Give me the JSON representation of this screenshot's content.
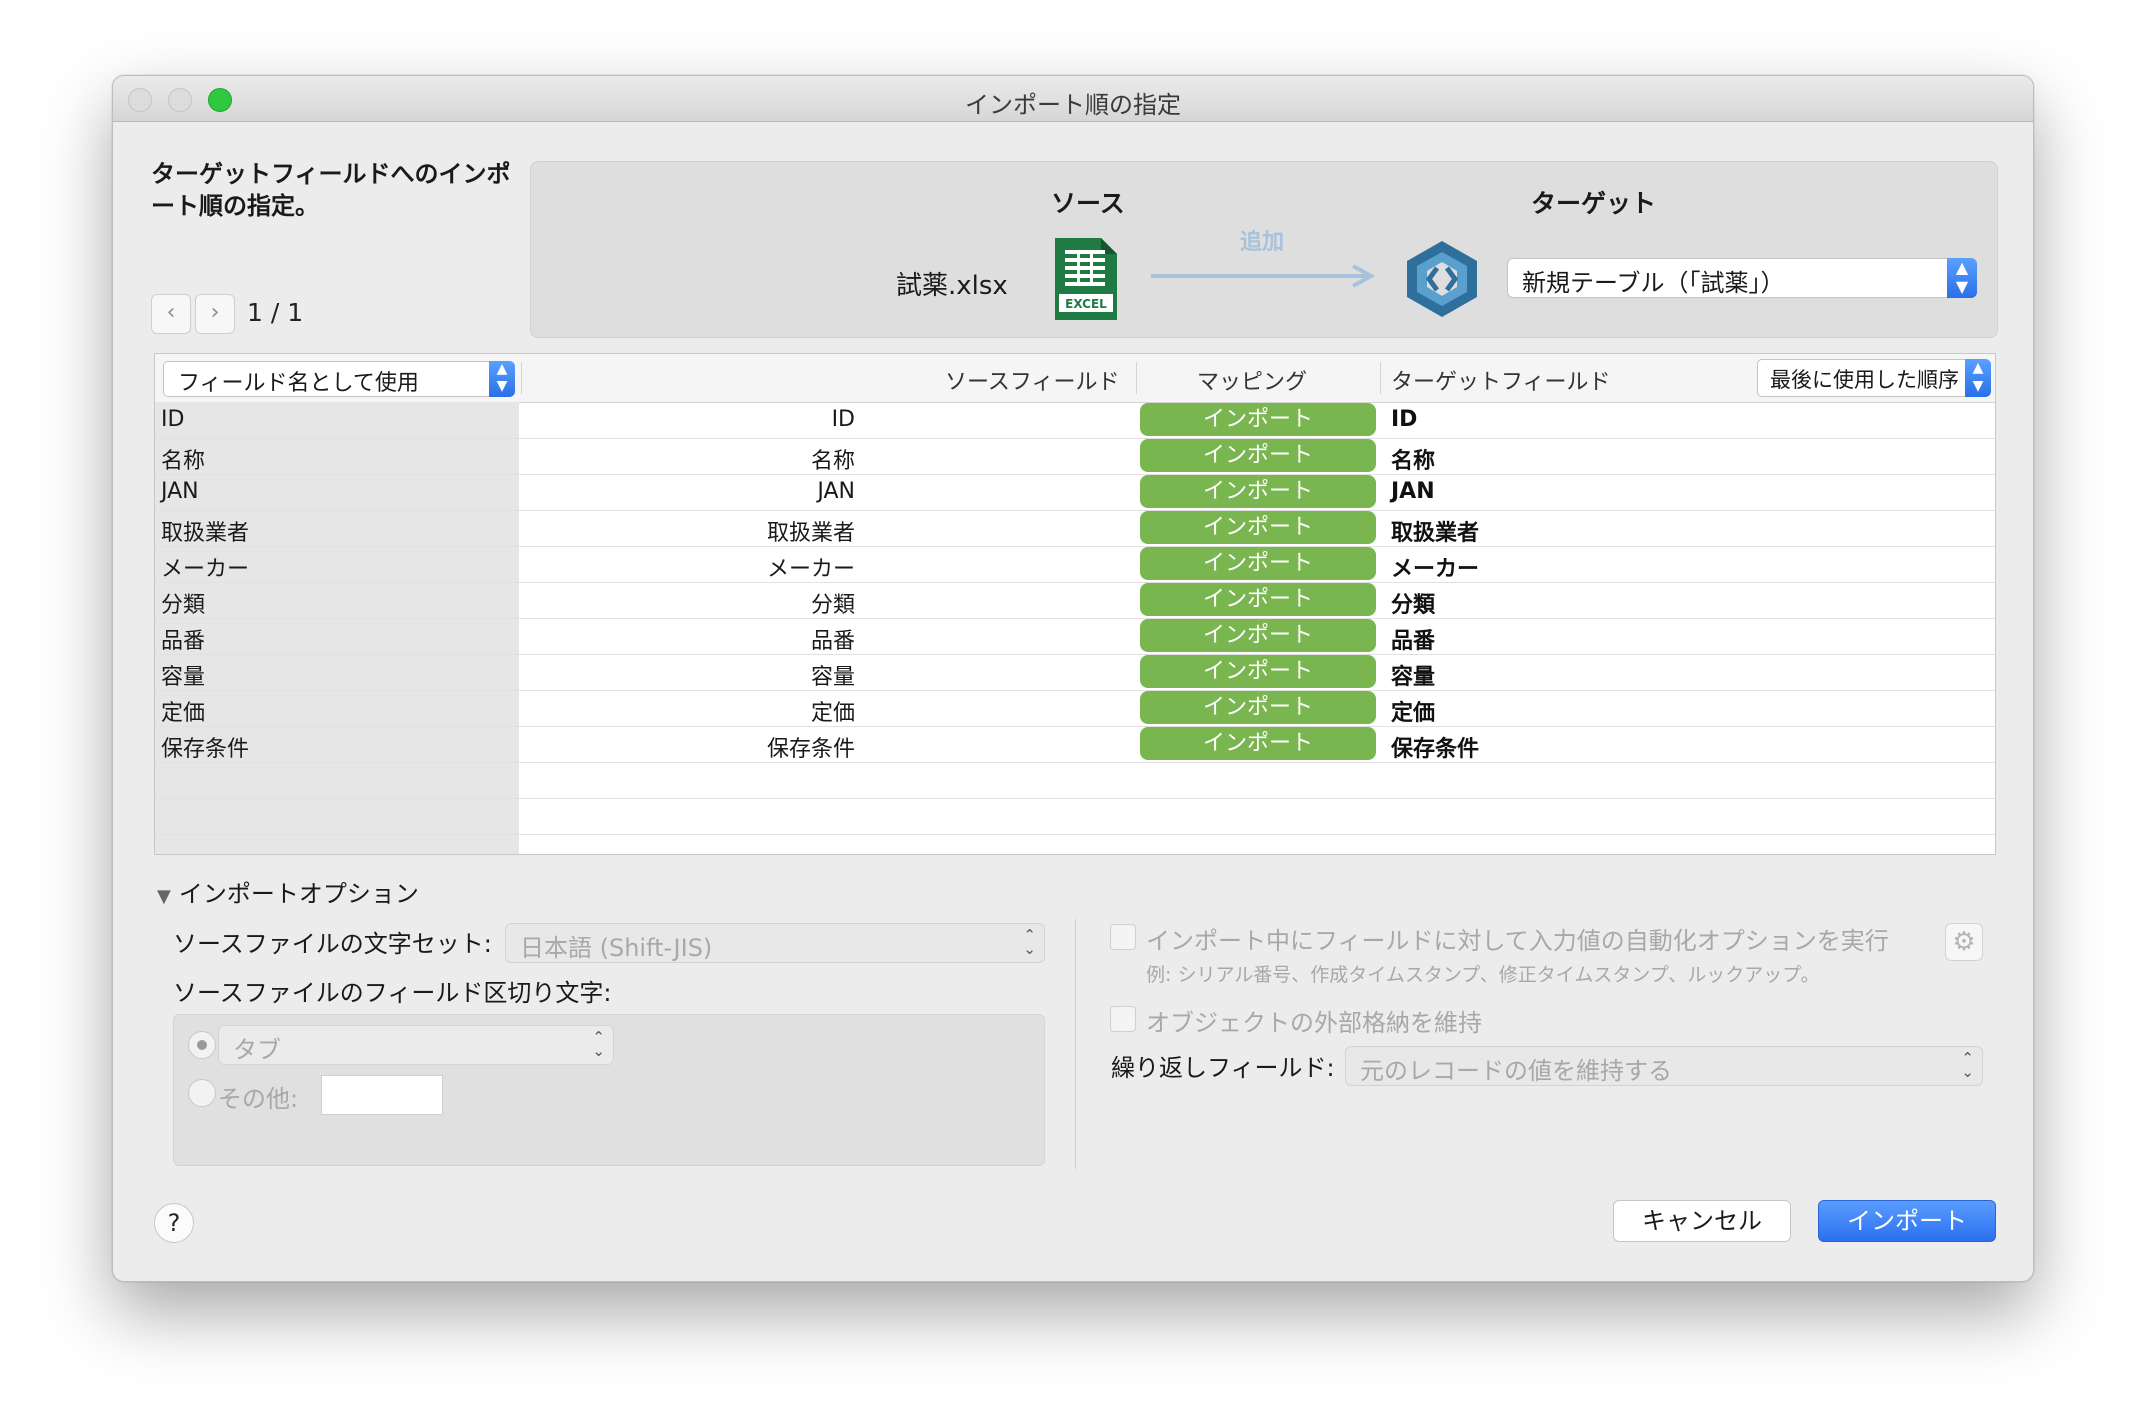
{
  "window": {
    "title": "インポート順の指定"
  },
  "heading": "ターゲットフィールドへのインポート順の指定。",
  "nav": {
    "prev_icon": "chevron-left-icon",
    "next_icon": "chevron-right-icon",
    "page": "1 / 1"
  },
  "source": {
    "label": "ソース",
    "file": "試薬.xlsx",
    "icon": "excel-file-icon",
    "icon_text": "EXCEL"
  },
  "action": {
    "label": "追加"
  },
  "target": {
    "label": "ターゲット",
    "icon": "filemaker-icon",
    "table": "新規テーブル（「試薬」）"
  },
  "table": {
    "header_select": "フィールド名として使用",
    "col_source": "ソースフィールド",
    "col_mapping": "マッピング",
    "col_target": "ターゲットフィールド",
    "order_select": "最後に使用した順序",
    "rows": [
      {
        "left": "ID",
        "source": "ID",
        "mapping": "インポート",
        "target": "ID"
      },
      {
        "left": "名称",
        "source": "名称",
        "mapping": "インポート",
        "target": "名称"
      },
      {
        "left": "JAN",
        "source": "JAN",
        "mapping": "インポート",
        "target": "JAN"
      },
      {
        "left": "取扱業者",
        "source": "取扱業者",
        "mapping": "インポート",
        "target": "取扱業者"
      },
      {
        "left": "メーカー",
        "source": "メーカー",
        "mapping": "インポート",
        "target": "メーカー"
      },
      {
        "left": "分類",
        "source": "分類",
        "mapping": "インポート",
        "target": "分類"
      },
      {
        "left": "品番",
        "source": "品番",
        "mapping": "インポート",
        "target": "品番"
      },
      {
        "left": "容量",
        "source": "容量",
        "mapping": "インポート",
        "target": "容量"
      },
      {
        "left": "定価",
        "source": "定価",
        "mapping": "インポート",
        "target": "定価"
      },
      {
        "left": "保存条件",
        "source": "保存条件",
        "mapping": "インポート",
        "target": "保存条件"
      }
    ]
  },
  "options": {
    "heading": "インポートオプション",
    "charset_label": "ソースファイルの文字セット:",
    "charset_value": "日本語 (Shift-JIS)",
    "delimiter_label": "ソースファイルのフィールド区切り文字:",
    "tab_value": "タブ",
    "other_label": "その他:",
    "other_value": "",
    "auto_enter_label": "インポート中にフィールドに対して入力値の自動化オプションを実行",
    "auto_enter_example": "例: シリアル番号、作成タイムスタンプ、修正タイムスタンプ、ルックアップ。",
    "keep_external_label": "オブジェクトの外部格納を維持",
    "repeat_label": "繰り返しフィールド:",
    "repeat_value": "元のレコードの値を維持する"
  },
  "buttons": {
    "help": "?",
    "cancel": "キャンセル",
    "import": "インポート"
  },
  "colors": {
    "mapping_pill": "#7ab650",
    "primary_button": "#2b6ff0",
    "zoom_green": "#2fc840"
  }
}
